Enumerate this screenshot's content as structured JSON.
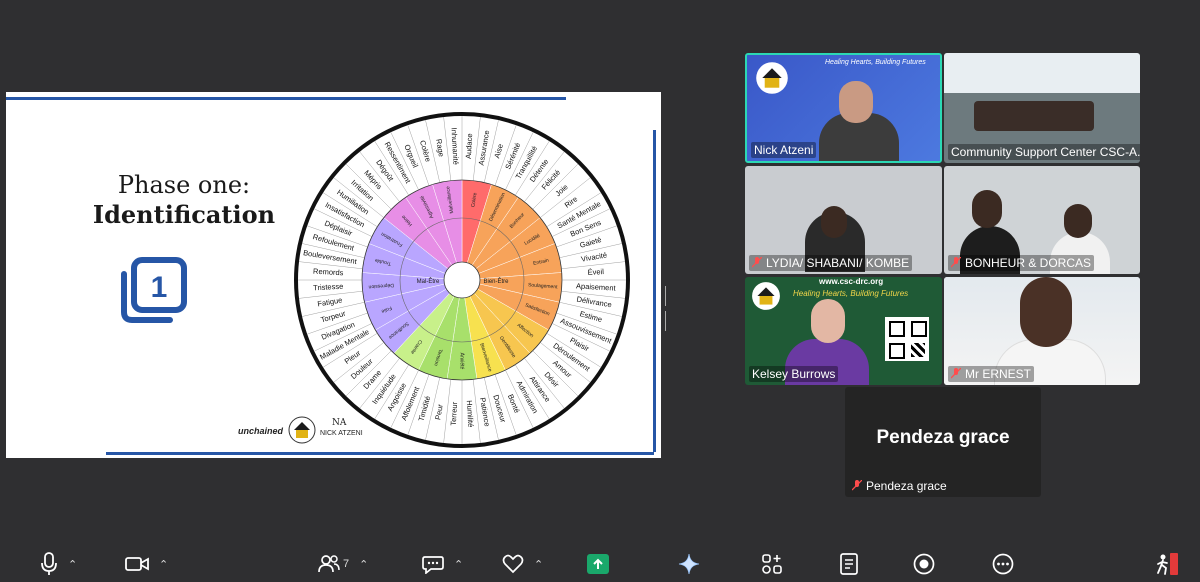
{
  "slide": {
    "title_line1": "Phase one:",
    "title_line2": "Identification",
    "step_number": "1",
    "logo_left": "unchained",
    "logo_right_line1": "NA",
    "logo_right_line2": "NICK ATZENI",
    "wheel": {
      "center": [
        "Mal-Être",
        "Bien-Être"
      ],
      "inner": [
        "Colère",
        "Détermination",
        "Bonheur",
        "Lucidité",
        "Entrain",
        "Soulagement",
        "Satisfaction",
        "Affection",
        "Gentillesse",
        "Bienveillance",
        "Anxiété",
        "Tension",
        "Crainte",
        "Souffrance",
        "Folie",
        "Dépression",
        "Trouble",
        "Frustration",
        "Haine",
        "Agressivité",
        "Malveillance"
      ],
      "outer": [
        "Audace",
        "Assurance",
        "Aise",
        "Sérénité",
        "Tranquillité",
        "Détente",
        "Félicité",
        "Joie",
        "Rire",
        "Santé Mentale",
        "Bon Sens",
        "Gaieté",
        "Vivacité",
        "Éveil",
        "Apaisement",
        "Délivrance",
        "Estime",
        "Assouvissement",
        "Plaisir",
        "Déroulement",
        "Amour",
        "Désir",
        "Attirance",
        "Admiration",
        "Bonté",
        "Douceur",
        "Patience",
        "Humilité",
        "Terreur",
        "Peur",
        "Timidité",
        "Affolement",
        "Angoisse",
        "Inquiétude",
        "Drame",
        "Douleur",
        "Pleur",
        "Maladie Mentale",
        "Divagation",
        "Torpeur",
        "Fatigue",
        "Tristesse",
        "Remords",
        "Bouleversement",
        "Refoulement",
        "Déplaisir",
        "Insatisfaction",
        "Humiliation",
        "Irritation",
        "Mépris",
        "Dégoût",
        "Ressentiment",
        "Orgueil",
        "Colère",
        "Rage",
        "Inhumanité"
      ]
    }
  },
  "participants": [
    {
      "name": "Nick Atzeni",
      "muted": false,
      "banner": "Healing Hearts, Building Futures"
    },
    {
      "name": "Community Support Center CSC-A...",
      "muted": false
    },
    {
      "name": "LYDIA/ SHABANI/ KOMBE",
      "muted": true
    },
    {
      "name": "BONHEUR & DORCAS",
      "muted": true
    },
    {
      "name": "Kelsey Burrows",
      "muted": false,
      "banner": "www.csc-drc.org",
      "banner2": "Healing Hearts, Building Futures"
    },
    {
      "name": "Mr ERNEST",
      "muted": true
    },
    {
      "name": "Pendeza grace",
      "muted": true
    }
  ],
  "toolbar": {
    "participants_count": "7",
    "icons": [
      "microphone-icon",
      "camera-icon",
      "people-icon",
      "chat-icon",
      "heart-icon",
      "share-icon",
      "sparkle-icon",
      "apps-icon",
      "notes-icon",
      "record-icon",
      "more-icon",
      "leave-icon"
    ]
  },
  "colors": {
    "background": "#2f2f31",
    "active_border": "#2cd8b4",
    "share_green": "#1aa86b",
    "slide_blue": "#2656a6"
  }
}
